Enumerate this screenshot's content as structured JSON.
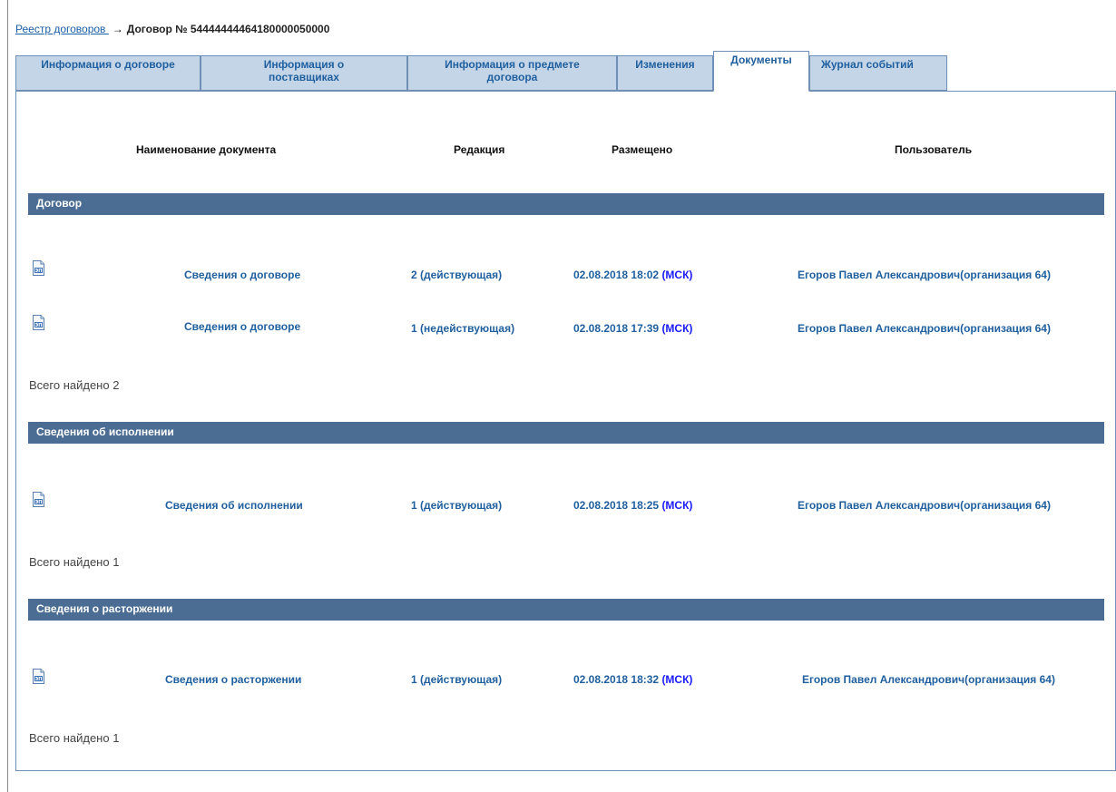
{
  "breadcrumb": {
    "registry_link": "Реестр договоров ",
    "arrow": "→",
    "current": "Договор № 54444444464180000050000"
  },
  "tabs": [
    {
      "label": "Информация о договоре"
    },
    {
      "label": "Информация о поставщиках"
    },
    {
      "label": "Информация о предмете договора"
    },
    {
      "label": "Изменения"
    },
    {
      "label": "Документы",
      "active": true
    },
    {
      "label": "Журнал событий"
    }
  ],
  "columns": {
    "name": "Наименование документа",
    "edition": "Редакция",
    "posted": "Размещено",
    "user": "Пользователь"
  },
  "sections": [
    {
      "title": "Договор",
      "rows": [
        {
          "name": "Сведения о договоре",
          "edition": "2 (действующая)",
          "date": "02.08.2018 18:02",
          "tz": "(МСК)",
          "user": "Егоров Павел Александрович(организация 64)"
        },
        {
          "name": "Сведения о договоре",
          "edition": "1 (недействующая)",
          "date": "02.08.2018 17:39",
          "tz": "(МСК)",
          "user": "Егоров Павел Александрович(организация 64)"
        }
      ],
      "total": "Всего найдено 2"
    },
    {
      "title": "Сведения об исполнении",
      "rows": [
        {
          "name": "Сведения об исполнении",
          "edition": "1 (действующая)",
          "date": "02.08.2018 18:25",
          "tz": "(МСК)",
          "user": "Егоров Павел Александрович(организация 64)"
        }
      ],
      "total": "Всего найдено 1"
    },
    {
      "title": "Сведения о расторжении",
      "rows": [
        {
          "name": "Сведения о расторжении",
          "edition": "1 (действующая)",
          "date": "02.08.2018 18:32",
          "tz": "(МСК)",
          "user": "Егоров Павел Александрович(организация 64)"
        }
      ],
      "total": "Всего найдено 1"
    }
  ],
  "icon": {
    "name": "document-signed-icon",
    "badge": "ЭП"
  },
  "colors": {
    "section_bar": "#4b6c93",
    "tab_bg": "#c5d5e8",
    "link": "#1f5f9e"
  }
}
